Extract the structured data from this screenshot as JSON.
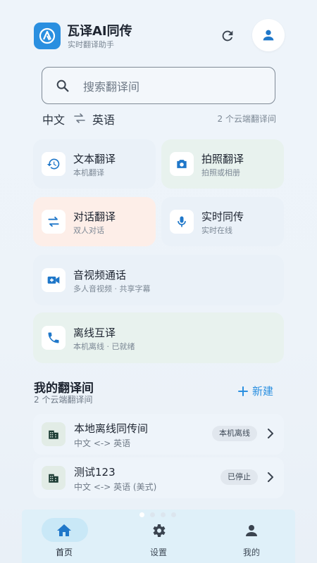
{
  "header": {
    "app_title": "瓦译AI同传",
    "app_subtitle": "实时翻译助手",
    "logo_icon": "app-logo-icon",
    "refresh_icon": "refresh-icon",
    "profile_icon": "person-icon"
  },
  "search": {
    "placeholder": "搜索翻译间",
    "source_lang": "中文",
    "target_lang": "英语",
    "room_count": "2 个云端翻译间"
  },
  "features": [
    {
      "title": "文本翻译",
      "subtitle": "本机翻译",
      "icon": "history-icon",
      "bg": "#eaf1f8"
    },
    {
      "title": "拍照翻译",
      "subtitle": "拍照或相册",
      "icon": "camera-icon",
      "bg": "#e8f2ee"
    },
    {
      "title": "对话翻译",
      "subtitle": "双人对话",
      "icon": "swap-icon",
      "bg": "#fdeee8"
    },
    {
      "title": "实时同传",
      "subtitle": "实时在线",
      "icon": "mic-icon",
      "bg": "#eaf1f8"
    },
    {
      "title": "音视频通话",
      "subtitle": "多人音视频 · 共享字幕",
      "icon": "video-call-icon",
      "bg": "#eaf1f8"
    },
    {
      "title": "离线互译",
      "subtitle": "本机离线 · 已就绪",
      "icon": "phone-icon",
      "bg": "#e8f2ee"
    }
  ],
  "my_rooms": {
    "title": "我的翻译间",
    "subtitle": "2 个云端翻译间",
    "new_label": "新建",
    "items": [
      {
        "name": "本地离线同传间",
        "langs": "中文 <-> 英语",
        "status": "本机离线"
      },
      {
        "name": "测试123",
        "langs": "中文 <-> 英语 (美式)",
        "status": "已停止"
      }
    ]
  },
  "nav": [
    {
      "label": "首页",
      "icon": "home-icon",
      "active": true
    },
    {
      "label": "设置",
      "icon": "gear-icon",
      "active": false
    },
    {
      "label": "我的",
      "icon": "person-icon",
      "active": false
    }
  ],
  "colors": {
    "accent": "#2a8fe0",
    "icon_blue": "#1f77c9",
    "background": "#eef4fa",
    "nav_background": "#dff0f9"
  }
}
